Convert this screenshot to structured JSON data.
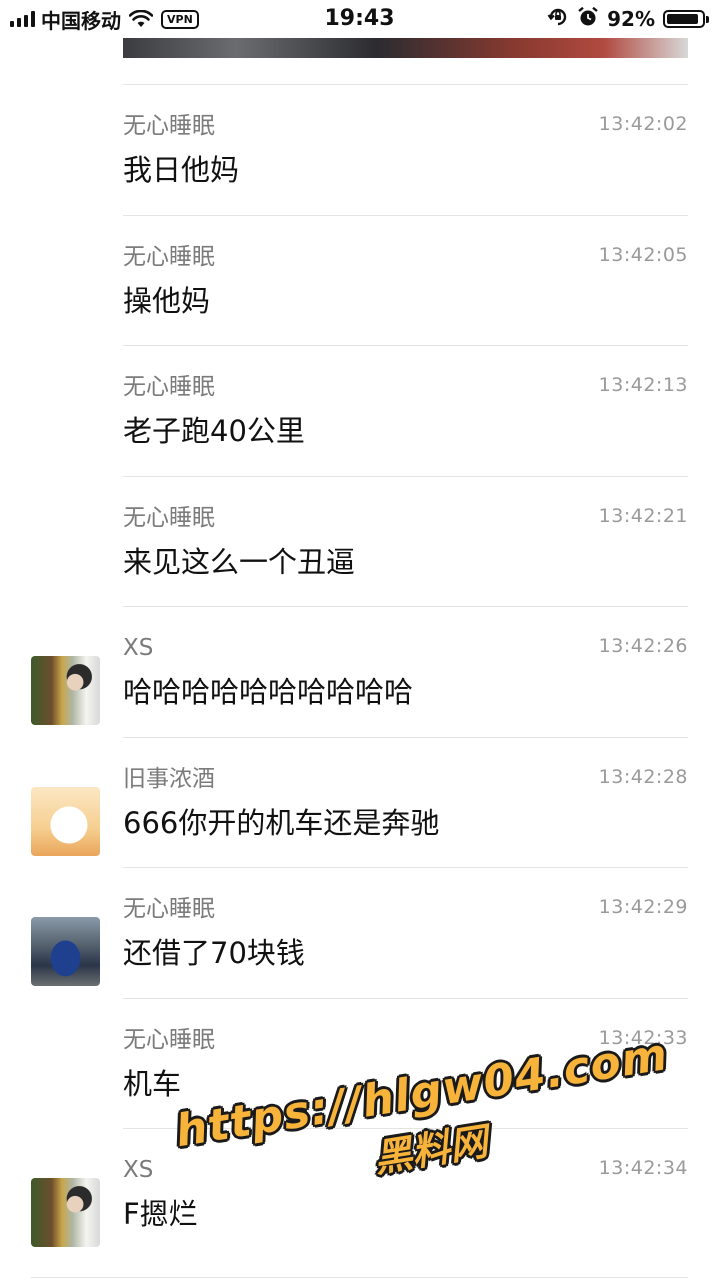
{
  "status_bar": {
    "carrier": "中国移动",
    "vpn": "VPN",
    "time": "19:43",
    "battery_percent": "92%",
    "battery_level": 0.92,
    "icons": [
      "signal-icon",
      "wifi-icon",
      "vpn-icon",
      "rotation-lock-icon",
      "alarm-icon",
      "battery-icon"
    ]
  },
  "messages": [
    {
      "name": "无心睡眠",
      "time": "13:42:02",
      "text": "我日他妈",
      "avatar": null
    },
    {
      "name": "无心睡眠",
      "time": "13:42:05",
      "text": "操他妈",
      "avatar": null
    },
    {
      "name": "无心睡眠",
      "time": "13:42:13",
      "text": "老子跑40公里",
      "avatar": null
    },
    {
      "name": "无心睡眠",
      "time": "13:42:21",
      "text": "来见这么一个丑逼",
      "avatar": null
    },
    {
      "name": "XS",
      "time": "13:42:26",
      "text": "哈哈哈哈哈哈哈哈哈哈",
      "avatar": "xs"
    },
    {
      "name": "旧事浓酒",
      "time": "13:42:28",
      "text": "666你开的机车还是奔驰",
      "avatar": "old"
    },
    {
      "name": "无心睡眠",
      "time": "13:42:29",
      "text": "还借了70块钱",
      "avatar": "car"
    },
    {
      "name": "无心睡眠",
      "time": "13:42:33",
      "text": "机车",
      "avatar": null
    },
    {
      "name": "XS",
      "time": "13:42:34",
      "text": "F摁烂",
      "avatar": "xs"
    }
  ],
  "watermark": {
    "url": "https://hlgw04.com",
    "label": "黑料网"
  }
}
